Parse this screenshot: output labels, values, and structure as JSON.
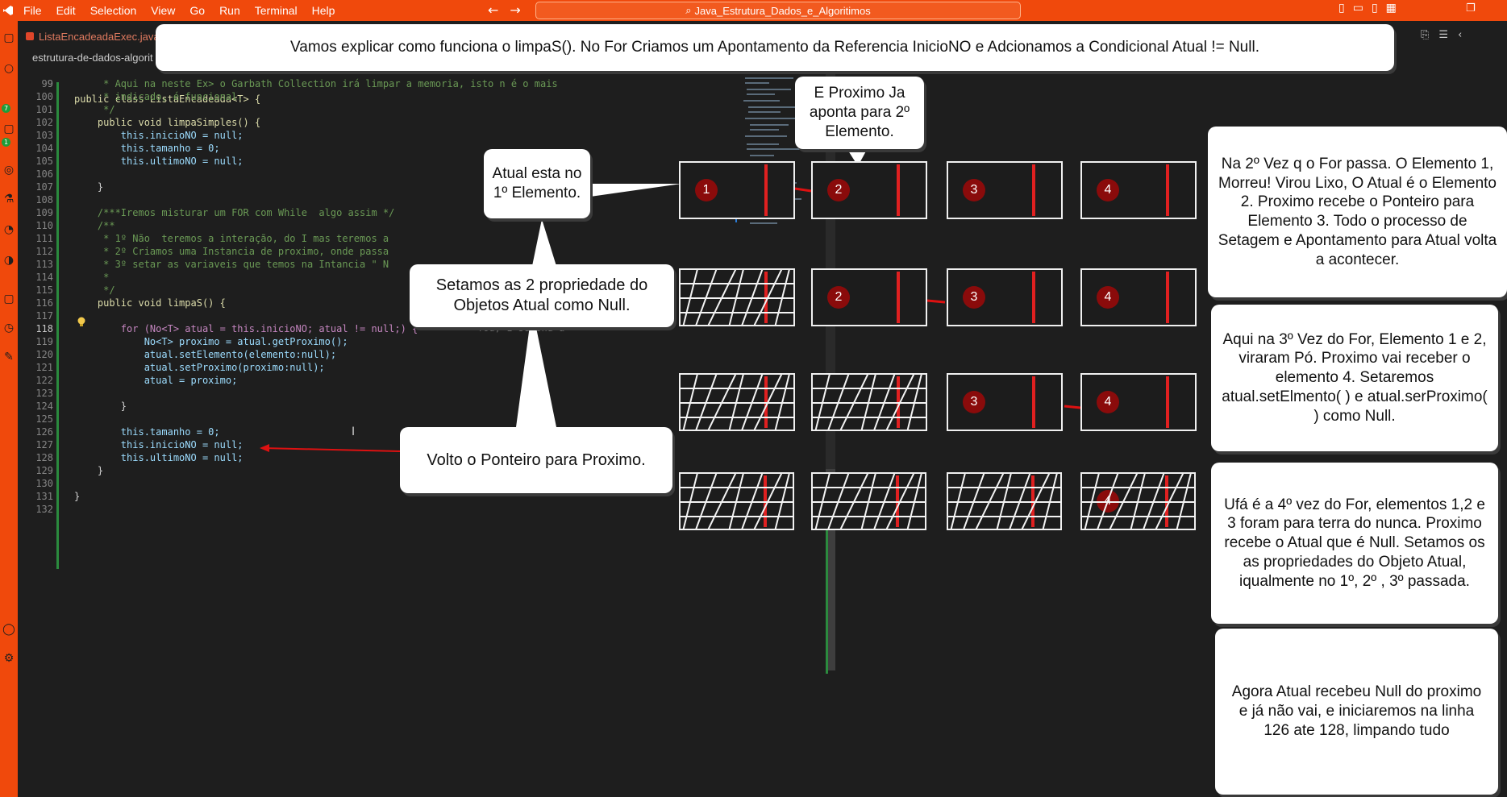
{
  "menu": [
    "File",
    "Edit",
    "Selection",
    "View",
    "Go",
    "Run",
    "Terminal",
    "Help"
  ],
  "search": {
    "text": "Java_Estrutura_Dados_e_Algoritimos"
  },
  "tab": {
    "label": "ListaEncadeadaExec.java"
  },
  "breadcrumb": "estrutura-de-dados-algorit",
  "header_code": "public class ListaEncadeada<T> {",
  "header_line": "9",
  "lines": [
    {
      "n": "99",
      "t": "     * Aqui na neste Ex> o Garbath Collection irá limpar a memoria, isto n é o mais"
    },
    {
      "n": "100",
      "t": "     * indicado, é funcional."
    },
    {
      "n": "101",
      "t": "     */"
    },
    {
      "n": "102",
      "t": "    public void limpaSimples() {"
    },
    {
      "n": "103",
      "t": "        this.inicioNO = null;"
    },
    {
      "n": "104",
      "t": "        this.tamanho = 0;"
    },
    {
      "n": "105",
      "t": "        this.ultimoNO = null;"
    },
    {
      "n": "106",
      "t": ""
    },
    {
      "n": "107",
      "t": "    }"
    },
    {
      "n": "108",
      "t": ""
    },
    {
      "n": "109",
      "t": "    /***Iremos misturar um FOR com While  algo assim */"
    },
    {
      "n": "110",
      "t": "    /**"
    },
    {
      "n": "111",
      "t": "     * 1º Não  teremos a interação, do I mas teremos a"
    },
    {
      "n": "112",
      "t": "     * 2º Criamos uma Instancia de proximo, onde passa"
    },
    {
      "n": "113",
      "t": "     * 3º setar as variaveis que temos na Intancia \" N"
    },
    {
      "n": "114",
      "t": "     *"
    },
    {
      "n": "115",
      "t": "     */"
    },
    {
      "n": "116",
      "t": "    public void limpaS() {"
    },
    {
      "n": "117",
      "t": ""
    },
    {
      "n": "118",
      "t": "        for (No<T> atual = this.inicioNO; atual != null;) {"
    },
    {
      "n": "119",
      "t": "            No<T> proximo = atual.getProximo();"
    },
    {
      "n": "120",
      "t": "            atual.setElemento(elemento:null);"
    },
    {
      "n": "121",
      "t": "            atual.setProximo(proximo:null);"
    },
    {
      "n": "122",
      "t": "            atual = proximo;"
    },
    {
      "n": "123",
      "t": ""
    },
    {
      "n": "124",
      "t": "        }"
    },
    {
      "n": "125",
      "t": ""
    },
    {
      "n": "126",
      "t": "        this.tamanho = 0;"
    },
    {
      "n": "127",
      "t": "        this.inicioNO = null;"
    },
    {
      "n": "128",
      "t": "        this.ultimoNO = null;"
    },
    {
      "n": "129",
      "t": "    }"
    },
    {
      "n": "130",
      "t": ""
    },
    {
      "n": "131",
      "t": "}"
    },
    {
      "n": "132",
      "t": ""
    }
  ],
  "blame": "You, 1 second ago • Uncommitted",
  "callouts": {
    "top": "Vamos explicar como funciona o limpaS(). No For Criamos um Apontamento da Referencia InicioNO e Adcionamos a Condicional Atual != Null.",
    "atual": "Atual esta no 1º Elemento.",
    "proximo": "E Proximo Ja aponta para 2º Elemento.",
    "setamos": "Setamos as 2 propriedade do Objetos Atual como Null.",
    "volto": "Volto o Ponteiro para Proximo.",
    "r1": "Na 2º Vez q o For passa. O Elemento 1, Morreu! Virou Lixo, O Atual é o Elemento 2. Proximo recebe o Ponteiro para Elemento 3. Todo o processo de Setagem e Apontamento para Atual volta a acontecer.",
    "r2": "Aqui na 3º Vez do For, Elemento 1 e 2, viraram Pó. Proximo vai receber o elemento 4. Setaremos atual.setElmento( ) e atual.serProximo( ) como Null.",
    "r3": "Ufá é a 4º vez do For, elementos 1,2 e 3 foram para terra do nunca. Proximo recebe o Atual que é Null. Setamos os as propriedades do Objeto Atual, iqualmente no 1º, 2º , 3º passada.",
    "r4": "Agora Atual  recebeu Null do proximo e já não vai, e iniciaremos na linha  126 ate 128, limpando tudo"
  },
  "rows": [
    [
      "1",
      "2",
      "3",
      "4"
    ],
    [
      "",
      "2",
      "3",
      "4"
    ],
    [
      "",
      "",
      "3",
      "4"
    ],
    [
      "",
      "",
      "",
      "4"
    ]
  ]
}
